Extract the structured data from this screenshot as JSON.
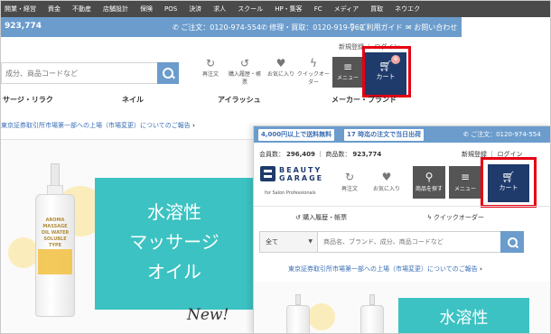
{
  "back_page": {
    "top_nav": [
      "開業・経営",
      "資金",
      "不動産",
      "店舗設計",
      "保険",
      "POS",
      "決済",
      "求人",
      "スクール",
      "HP・集客",
      "FC",
      "メディア",
      "買取",
      "ネウエク"
    ],
    "info_bar": {
      "number": "923,774",
      "phone_order": "ご注文：0120-974-554",
      "phone_repair": "修理・買取：0120-919-969",
      "guide": "ご利用ガイド",
      "contact": "お問い合わせ"
    },
    "search_placeholder": "成分、商品コードなど",
    "icons": {
      "reorder": "再注文",
      "history": "購入履歴・帳票",
      "favorites": "お気に入り",
      "quick_order": "クイックオーダー",
      "menu": "メニュー",
      "cart": "カート",
      "cart_count": "6"
    },
    "new_register": "新規登録",
    "login": "ログイン",
    "categories": [
      "サージ・リラク",
      "ネイル",
      "アイラッシュ",
      "メーカー・ブランド"
    ],
    "announcement": "東京証券取引所市場第一部への上場（市場変更）についてのご報告",
    "banner": {
      "headline_lines": [
        "水溶性",
        "マッサージ",
        "オイル"
      ],
      "script": "New!",
      "bottle_label": "AROMA MASSAGE OIL WATER SOLUBLE TYPE"
    }
  },
  "front_page": {
    "pills": [
      "4,000円以上で送料無料",
      "17 時迄の注文で当日出荷"
    ],
    "phone": "ご注文：0120-974-554",
    "member_label": "会員数：",
    "member_count": "296,409",
    "product_label": "商品数：",
    "product_count": "923,774",
    "new_register": "新規登録",
    "login": "ログイン",
    "logo": {
      "line1": "BEAUTY",
      "line2": "GARAGE",
      "tagline": "for Salon Professionals"
    },
    "icons": {
      "reorder": "再注文",
      "favorites": "お気に入り",
      "find": "商品を探す",
      "menu": "メニュー",
      "cart": "カート"
    },
    "history": "購入履歴・帳票",
    "quick_order": "クイックオーダー",
    "search": {
      "category": "全て",
      "placeholder": "商品名、ブランド、成分、商品コードなど"
    },
    "announcement": "東京証券取引所市場第一部への上場（市場変更）についてのご報告",
    "banner_headline": "水溶性"
  },
  "colors": {
    "accent_blue": "#6b9ccc",
    "navy": "#1f3b6b",
    "highlight_red": "#e60012",
    "teal": "#3cc2c2"
  }
}
